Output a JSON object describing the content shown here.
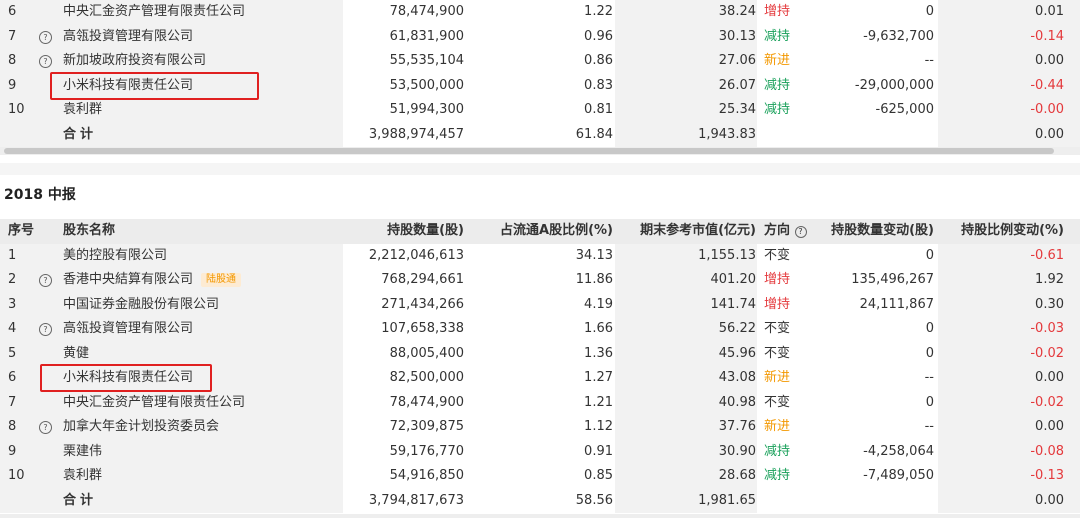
{
  "top_table": {
    "rows": [
      {
        "no": "6",
        "q": false,
        "name": "中央汇金资产管理有限责任公司",
        "qty": "78,474,900",
        "pct": "1.22",
        "val": "38.24",
        "dir": "增持",
        "dir_class": "red",
        "chg": "0",
        "chgp": "0.01",
        "chgp_class": ""
      },
      {
        "no": "7",
        "q": true,
        "name": "高瓴投資管理有限公司",
        "qty": "61,831,900",
        "pct": "0.96",
        "val": "30.13",
        "dir": "减持",
        "dir_class": "green",
        "chg": "-9,632,700",
        "chgp": "-0.14",
        "chgp_class": "red"
      },
      {
        "no": "8",
        "q": true,
        "name": "新加坡政府投资有限公司",
        "qty": "55,535,104",
        "pct": "0.86",
        "val": "27.06",
        "dir": "新进",
        "dir_class": "orange",
        "chg": "--",
        "chgp": "0.00",
        "chgp_class": ""
      },
      {
        "no": "9",
        "q": false,
        "name": "小米科技有限责任公司",
        "qty": "53,500,000",
        "pct": "0.83",
        "val": "26.07",
        "dir": "减持",
        "dir_class": "green",
        "chg": "-29,000,000",
        "chgp": "-0.44",
        "chgp_class": "red"
      },
      {
        "no": "10",
        "q": false,
        "name": "袁利群",
        "qty": "51,994,300",
        "pct": "0.81",
        "val": "25.34",
        "dir": "减持",
        "dir_class": "green",
        "chg": "-625,000",
        "chgp": "-0.00",
        "chgp_class": "red"
      }
    ],
    "total": {
      "name": "合计",
      "qty": "3,988,974,457",
      "pct": "61.84",
      "val": "1,943.83",
      "chgp": "0.00"
    }
  },
  "section2": {
    "title": "2018 中报",
    "headers": {
      "no": "序号",
      "name": "股东名称",
      "qty": "持股数量(股)",
      "pct": "占流通A股比例(%)",
      "val": "期末参考市值(亿元)",
      "dir": "方向",
      "chg": "持股数量变动(股)",
      "chgp": "持股比例变动(%)"
    },
    "rows": [
      {
        "no": "1",
        "q": false,
        "name": "美的控股有限公司",
        "qty": "2,212,046,613",
        "pct": "34.13",
        "val": "1,155.13",
        "dir": "不变",
        "dir_class": "",
        "chg": "0",
        "chgp": "-0.61",
        "chgp_class": "red"
      },
      {
        "no": "2",
        "q": true,
        "name": "香港中央結算有限公司",
        "tag": "陆股通",
        "qty": "768,294,661",
        "pct": "11.86",
        "val": "401.20",
        "dir": "增持",
        "dir_class": "red",
        "chg": "135,496,267",
        "chgp": "1.92",
        "chgp_class": ""
      },
      {
        "no": "3",
        "q": false,
        "name": "中国证券金融股份有限公司",
        "qty": "271,434,266",
        "pct": "4.19",
        "val": "141.74",
        "dir": "增持",
        "dir_class": "red",
        "chg": "24,111,867",
        "chgp": "0.30",
        "chgp_class": ""
      },
      {
        "no": "4",
        "q": true,
        "name": "高瓴投資管理有限公司",
        "qty": "107,658,338",
        "pct": "1.66",
        "val": "56.22",
        "dir": "不变",
        "dir_class": "",
        "chg": "0",
        "chgp": "-0.03",
        "chgp_class": "red"
      },
      {
        "no": "5",
        "q": false,
        "name": "黄健",
        "qty": "88,005,400",
        "pct": "1.36",
        "val": "45.96",
        "dir": "不变",
        "dir_class": "",
        "chg": "0",
        "chgp": "-0.02",
        "chgp_class": "red"
      },
      {
        "no": "6",
        "q": false,
        "name": "小米科技有限责任公司",
        "qty": "82,500,000",
        "pct": "1.27",
        "val": "43.08",
        "dir": "新进",
        "dir_class": "orange",
        "chg": "--",
        "chgp": "0.00",
        "chgp_class": ""
      },
      {
        "no": "7",
        "q": false,
        "name": "中央汇金资产管理有限责任公司",
        "qty": "78,474,900",
        "pct": "1.21",
        "val": "40.98",
        "dir": "不变",
        "dir_class": "",
        "chg": "0",
        "chgp": "-0.02",
        "chgp_class": "red"
      },
      {
        "no": "8",
        "q": true,
        "name": "加拿大年金计划投资委员会",
        "qty": "72,309,875",
        "pct": "1.12",
        "val": "37.76",
        "dir": "新进",
        "dir_class": "orange",
        "chg": "--",
        "chgp": "0.00",
        "chgp_class": ""
      },
      {
        "no": "9",
        "q": false,
        "name": "栗建伟",
        "qty": "59,176,770",
        "pct": "0.91",
        "val": "30.90",
        "dir": "减持",
        "dir_class": "green",
        "chg": "-4,258,064",
        "chgp": "-0.08",
        "chgp_class": "red"
      },
      {
        "no": "10",
        "q": false,
        "name": "袁利群",
        "qty": "54,916,850",
        "pct": "0.85",
        "val": "28.68",
        "dir": "减持",
        "dir_class": "green",
        "chg": "-7,489,050",
        "chgp": "-0.13",
        "chgp_class": "red"
      }
    ],
    "total": {
      "name": "合计",
      "qty": "3,794,817,673",
      "pct": "58.56",
      "val": "1,981.65",
      "chgp": "0.00"
    }
  },
  "icons": {
    "question": "question-circle-icon"
  },
  "colors": {
    "increase": "#e4393c",
    "decrease": "#18a05a",
    "new": "#f39800",
    "highlight": "#e02020"
  }
}
